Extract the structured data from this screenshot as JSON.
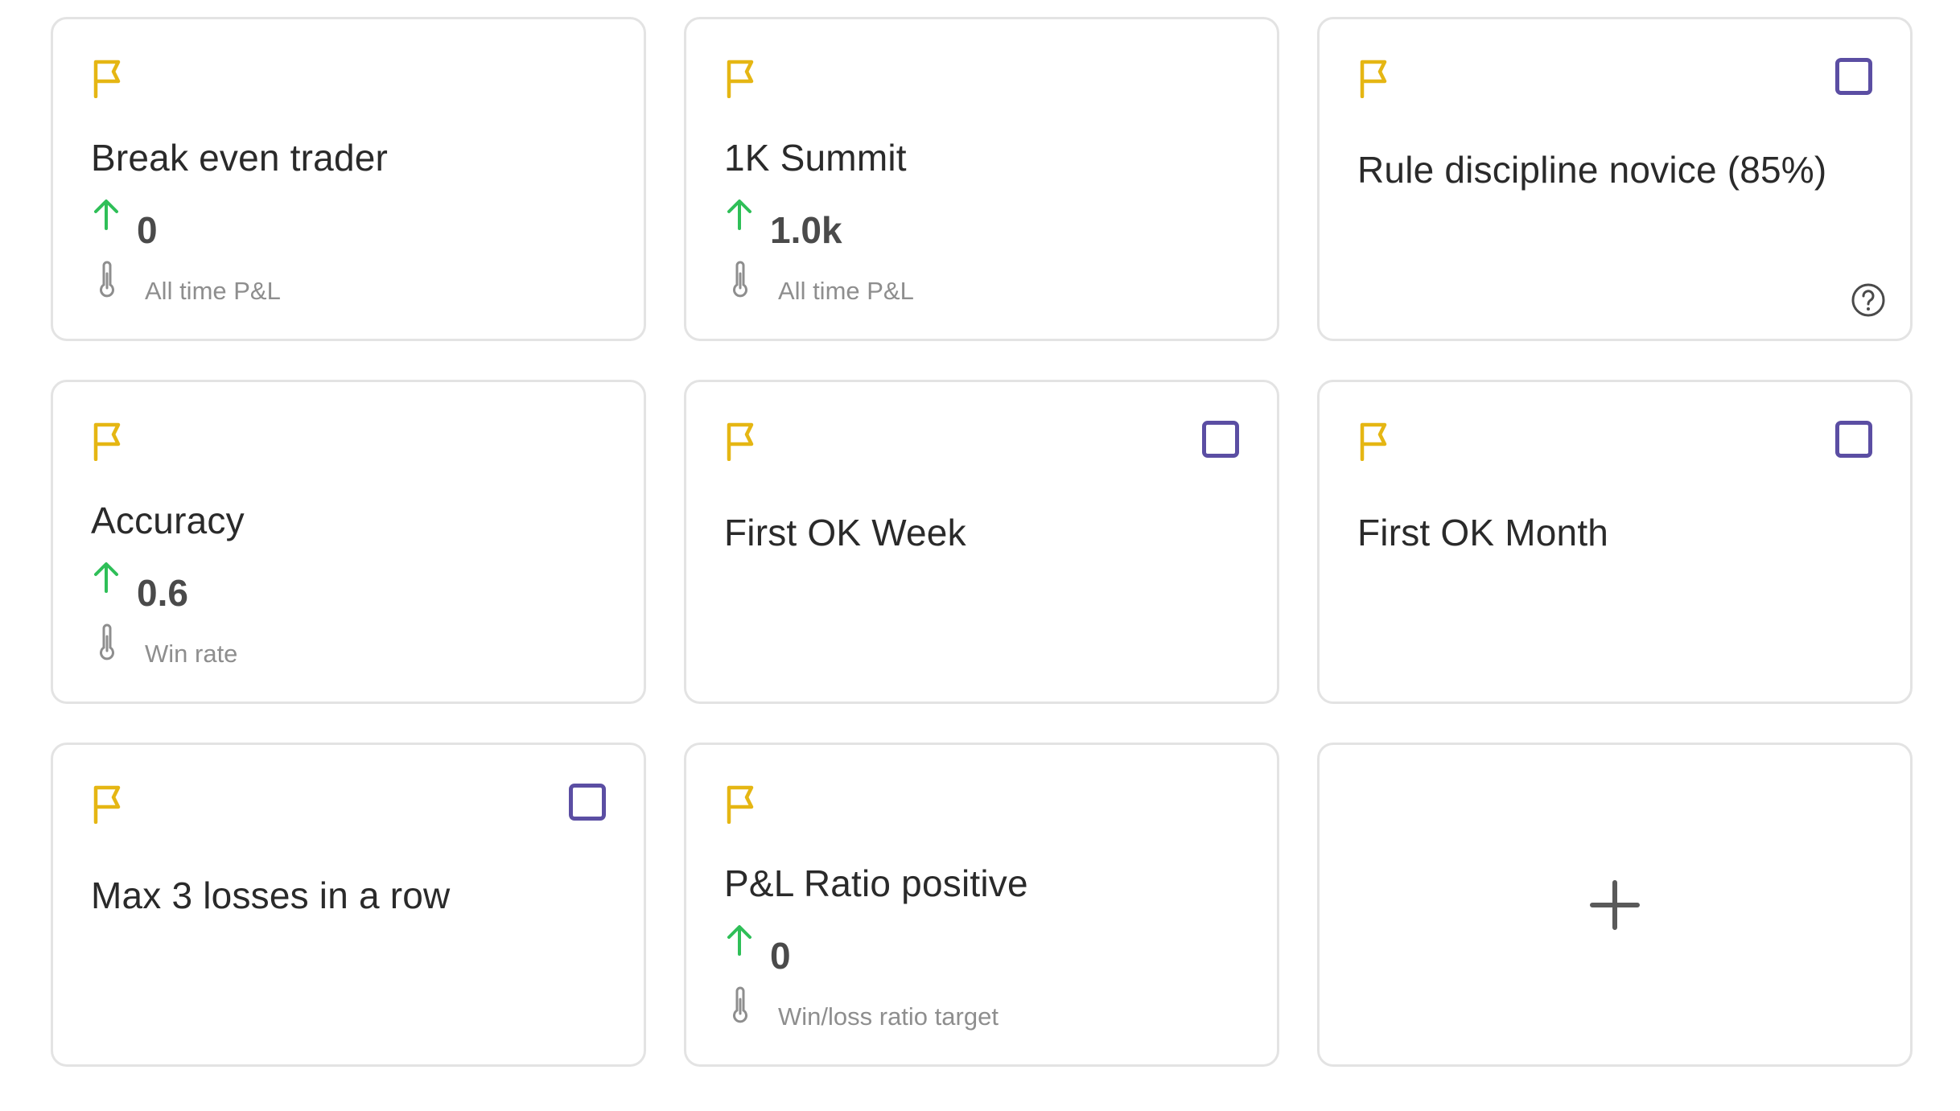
{
  "colors": {
    "flag": "#e5b613",
    "arrow_up": "#2fbf58",
    "checkbox": "#5b4ea3",
    "border": "#e3e3e3"
  },
  "cards": [
    {
      "title": "Break even trader",
      "value": "0",
      "metric": "All time P&L",
      "icon": "flag-icon",
      "trend_icon": "arrow-up-icon",
      "metric_icon": "thermometer-icon"
    },
    {
      "title": "1K Summit",
      "value": "1.0k",
      "metric": "All time P&L",
      "icon": "flag-icon",
      "trend_icon": "arrow-up-icon",
      "metric_icon": "thermometer-icon"
    },
    {
      "title": "Rule discipline novice (85%)",
      "icon": "flag-icon",
      "checkbox": false,
      "help_icon": "question-circle-icon"
    },
    {
      "title": "Accuracy",
      "value": "0.6",
      "metric": "Win rate",
      "icon": "flag-icon",
      "trend_icon": "arrow-up-icon",
      "metric_icon": "thermometer-icon"
    },
    {
      "title": "First OK Week",
      "icon": "flag-icon",
      "checkbox": false
    },
    {
      "title": "First OK Month",
      "icon": "flag-icon",
      "checkbox": false
    },
    {
      "title": "Max 3 losses in a row",
      "icon": "flag-icon",
      "checkbox": false
    },
    {
      "title": "P&L Ratio positive",
      "value": "0",
      "metric": "Win/loss ratio target",
      "icon": "flag-icon",
      "trend_icon": "arrow-up-icon",
      "metric_icon": "thermometer-icon"
    }
  ],
  "add_card": {
    "icon": "plus-icon"
  }
}
